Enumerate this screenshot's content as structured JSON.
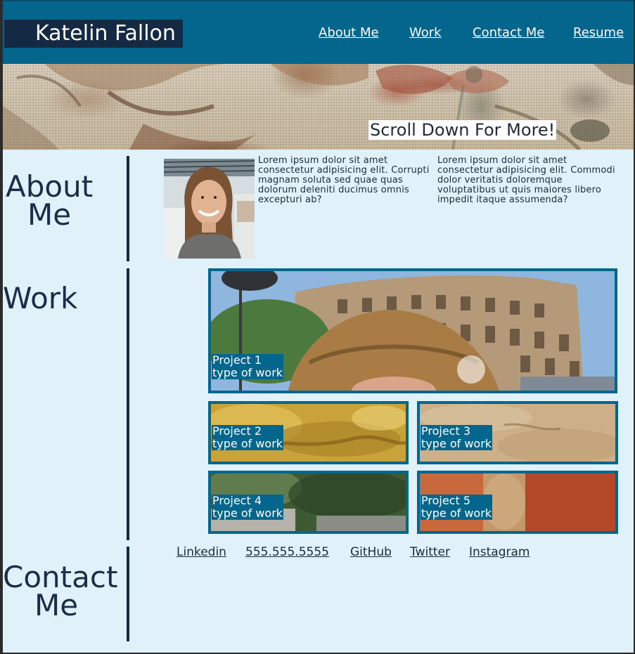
{
  "header": {
    "brand": "Katelin Fallon",
    "nav": [
      "About Me",
      "Work",
      "Contact Me",
      "Resume"
    ]
  },
  "hero": {
    "scroll_text": "Scroll Down For More!"
  },
  "about": {
    "title_line1": "About",
    "title_line2": "Me",
    "col1": "Lorem ipsum dolor sit amet consectetur adipisicing elit. Corrupti magnam soluta sed quae quas dolorum deleniti ducimus omnis excepturi ab?",
    "col2": "Lorem ipsum dolor sit amet consectetur adipisicing elit. Commodi dolor veritatis doloremque voluptatibus ut quis maiores libero impedit itaque assumenda?"
  },
  "work": {
    "title": "Work",
    "projects": [
      {
        "name": "Project 1",
        "type": "type of work"
      },
      {
        "name": "Project 2",
        "type": "type of work"
      },
      {
        "name": "Project 3",
        "type": "type of work"
      },
      {
        "name": "Project 4",
        "type": "type of work"
      },
      {
        "name": "Project 5",
        "type": "type of work"
      }
    ]
  },
  "contact": {
    "title_line1": "Contact",
    "title_line2": "Me",
    "links": [
      "Linkedin",
      "555.555.5555",
      "GitHub",
      "Twitter",
      "Instagram"
    ]
  },
  "colors": {
    "header_bg": "#05668d",
    "brand_bg": "#142a44",
    "page_bg": "#e0f1f9",
    "text_dark": "#1a2e4a"
  }
}
